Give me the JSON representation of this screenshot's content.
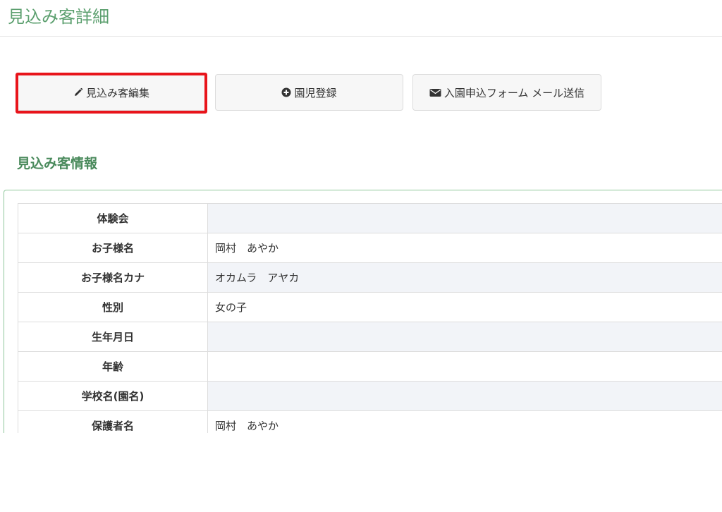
{
  "header": {
    "title": "見込み客詳細"
  },
  "actions": {
    "edit_label": "見込み客編集",
    "register_label": "園児登録",
    "mail_label": "入園申込フォーム メール送信",
    "edit_icon": "pencil-icon",
    "register_icon": "plus-circle-icon",
    "mail_icon": "envelope-icon"
  },
  "section": {
    "title": "見込み客情報"
  },
  "info_rows": [
    {
      "label": "体験会",
      "value": ""
    },
    {
      "label": "お子様名",
      "value": "岡村　あやか"
    },
    {
      "label": "お子様名カナ",
      "value": "オカムラ　アヤカ"
    },
    {
      "label": "性別",
      "value": "女の子"
    },
    {
      "label": "生年月日",
      "value": ""
    },
    {
      "label": "年齢",
      "value": ""
    },
    {
      "label": "学校名(園名)",
      "value": ""
    },
    {
      "label": "保護者名",
      "value": "岡村　あやか"
    }
  ],
  "colors": {
    "title_green": "#5b9f6e",
    "section_green": "#4a8a5c",
    "highlight_red": "#e8141b",
    "row_stripe": "#f2f4f8"
  }
}
